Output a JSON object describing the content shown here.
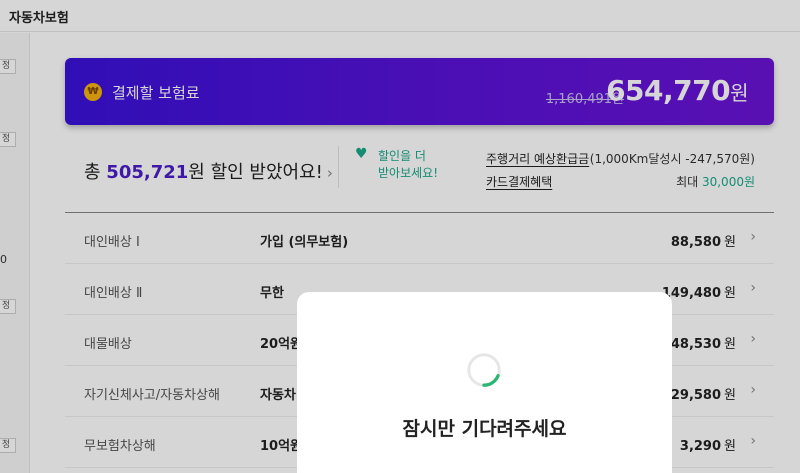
{
  "header": {
    "title": "자동차보험",
    "back_icon": "chevron-left-icon"
  },
  "left_strip": {
    "chips": [
      "정",
      "정",
      "정",
      "정"
    ],
    "number": "0"
  },
  "banner": {
    "label": "결제할 보험료",
    "coin_icon": "won-coin-icon",
    "coin_text": "₩",
    "original_price": "1,160,491원",
    "price": "654,770",
    "price_unit": "원",
    "gradient_colors": [
      "#3a11d9",
      "#6a14d6"
    ]
  },
  "summary": {
    "prefix": "총 ",
    "amount": "505,721",
    "suffix": "원 할인 받았어요!",
    "arrow": "›"
  },
  "promo": {
    "line1": "할인을 더",
    "line2": "받아보세요!",
    "color": "#1aa88a"
  },
  "benefits": [
    {
      "label": "주행거리 예상환급금",
      "value_plain": "(1,000Km달성시 -247,570원)",
      "value_highlight": ""
    },
    {
      "label": "카드결제혜택",
      "value_plain": "최대 ",
      "value_highlight": "30,000원"
    }
  ],
  "coverage_rows": [
    {
      "name": "대인배상 Ⅰ",
      "value": "가입 (의무보험)",
      "amount": "88,580",
      "unit": "원"
    },
    {
      "name": "대인배상 Ⅱ",
      "value": "무한",
      "amount": "149,480",
      "unit": "원"
    },
    {
      "name": "대물배상",
      "value": "20억원",
      "amount": "248,530",
      "unit": "원"
    },
    {
      "name": "자기신체사고/자동차상해",
      "value": "자동차",
      "amount": "29,580",
      "unit": "원"
    },
    {
      "name": "무보험차상해",
      "value": "10억원",
      "amount": "3,290",
      "unit": "원"
    }
  ],
  "loading_modal": {
    "message": "잠시만 기다려주세요",
    "spinner_color": "#2bb673"
  }
}
